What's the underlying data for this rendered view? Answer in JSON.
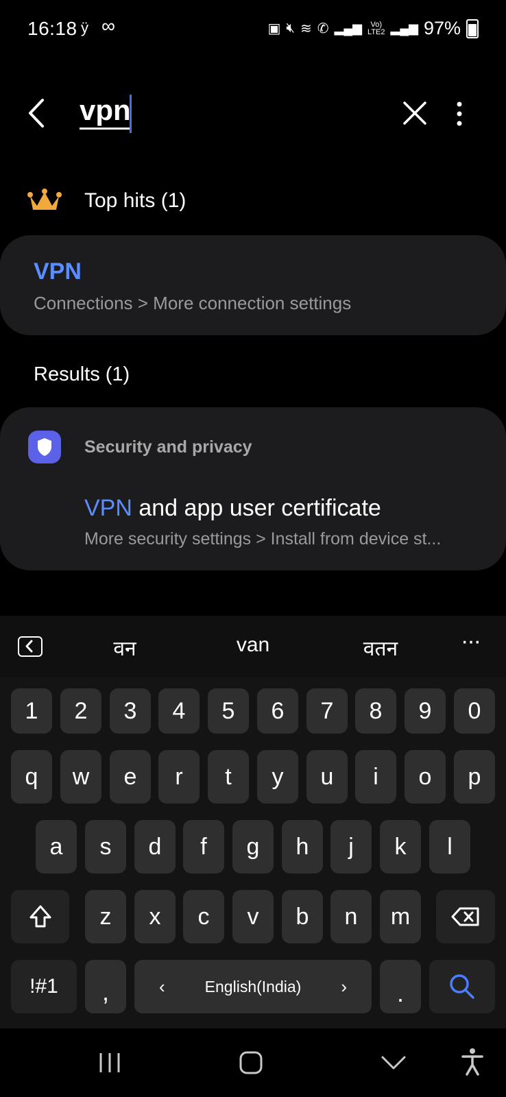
{
  "status_bar": {
    "time": "16:18",
    "indicator_1": "ÿ",
    "indicator_2": "∞",
    "battery": "97%"
  },
  "search": {
    "query": "vpn"
  },
  "top_hits": {
    "title": "Top hits (1)",
    "item": {
      "title": "VPN",
      "path": "Connections > More connection settings"
    }
  },
  "results": {
    "title": "Results (1)",
    "group": "Security and privacy",
    "item": {
      "title_highlight": "VPN",
      "title_rest": " and app user certificate",
      "path": "More security settings > Install from device st..."
    }
  },
  "keyboard": {
    "suggestions": [
      "वन",
      "van",
      "वतन"
    ],
    "more": "···",
    "row_numbers": [
      "1",
      "2",
      "3",
      "4",
      "5",
      "6",
      "7",
      "8",
      "9",
      "0"
    ],
    "row_1": [
      "q",
      "w",
      "e",
      "r",
      "t",
      "y",
      "u",
      "i",
      "o",
      "p"
    ],
    "row_2": [
      "a",
      "s",
      "d",
      "f",
      "g",
      "h",
      "j",
      "k",
      "l"
    ],
    "row_3": [
      "z",
      "x",
      "c",
      "v",
      "b",
      "n",
      "m"
    ],
    "symbols": "!#1",
    "comma": ",",
    "language": "English(India)",
    "period": ".",
    "accent_color": "#4a7dff"
  }
}
